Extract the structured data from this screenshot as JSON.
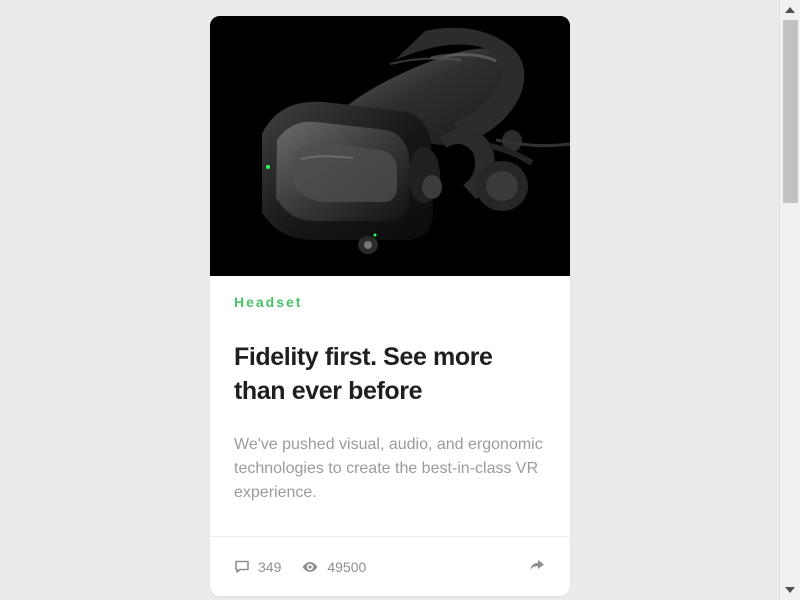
{
  "card": {
    "image_alt": "VR headset",
    "category": "Headset",
    "title": "Fidelity first. See more than ever before",
    "description": "We've pushed visual, audio, and ergonomic technologies to create the best-in-class VR experience."
  },
  "stats": {
    "comments_icon": "comment-icon",
    "comments": "349",
    "views_icon": "eye-icon",
    "views": "49500",
    "share_icon": "share-icon"
  },
  "colors": {
    "background": "#ebebeb",
    "card": "#ffffff",
    "accent": "#4ac16a",
    "title": "#1f1f1f",
    "muted": "#9b9b9b"
  }
}
